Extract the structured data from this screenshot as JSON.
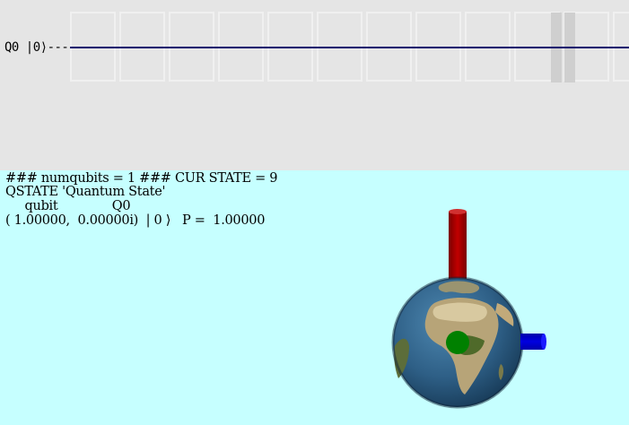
{
  "circuit": {
    "qubit_label": "Q0 |0⟩---",
    "wire_color": "#0a0a6e"
  },
  "state": {
    "line1": "### numqubits = 1 ### CUR STATE = 9",
    "line2": "QSTATE 'Quantum State'",
    "line3": "     qubit              Q0",
    "line4": "( 1.00000,  0.00000i)  | 0 ⟩   P =  1.00000",
    "background": "#c6ffff"
  },
  "bloch": {
    "z_arrow_color": "#b00000",
    "x_arrow_color": "#0000c8",
    "state_marker_color": "#008000",
    "sphere_icon": "earth-globe"
  }
}
